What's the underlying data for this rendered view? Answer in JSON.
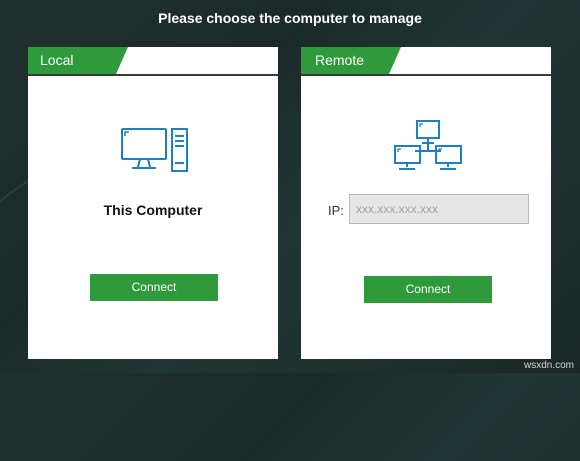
{
  "header": {
    "title": "Please choose the computer to manage"
  },
  "local": {
    "tab_label": "Local",
    "icon": "desktop-computer-icon",
    "computer_label": "This Computer",
    "connect_label": "Connect"
  },
  "remote": {
    "tab_label": "Remote",
    "icon": "network-icon",
    "ip_label": "IP:",
    "ip_placeholder": "xxx.xxx.xxx.xxx",
    "connect_label": "Connect"
  },
  "watermark": "wsxdn.com",
  "colors": {
    "accent_green": "#2e9a3b",
    "icon_blue": "#1f7fc0",
    "background": "#1f2e2d"
  }
}
